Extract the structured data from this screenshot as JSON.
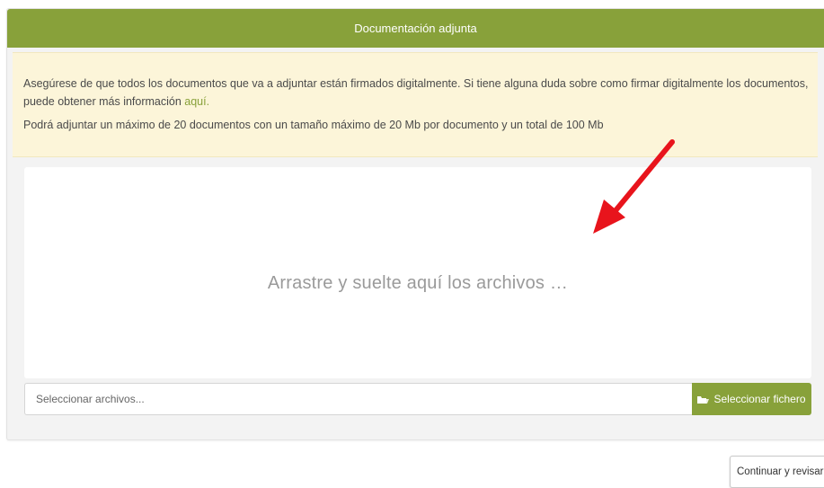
{
  "panel": {
    "title": "Documentación adjunta"
  },
  "notice": {
    "line1_text": "Asegúrese de que todos los documentos que va a adjuntar están firmados digitalmente. Si tiene alguna duda sobre como firmar digitalmente los documentos, puede obtener más información ",
    "link_label": "aquí.",
    "line2_text": "Podrá adjuntar un máximo de 20 documentos con un tamaño máximo de 20 Mb por documento y un total de 100 Mb"
  },
  "dropzone": {
    "text": "Arrastre y suelte aquí los archivos …"
  },
  "file_select": {
    "placeholder": "Seleccionar archivos...",
    "button_label": "Seleccionar fichero",
    "button_icon": "folder-open-icon"
  },
  "footer": {
    "continue_label": "Continuar y revisar »"
  },
  "colors": {
    "accent": "#88a13a",
    "notice_bg": "#fcf5d9",
    "annotation_arrow": "#e8141c"
  }
}
